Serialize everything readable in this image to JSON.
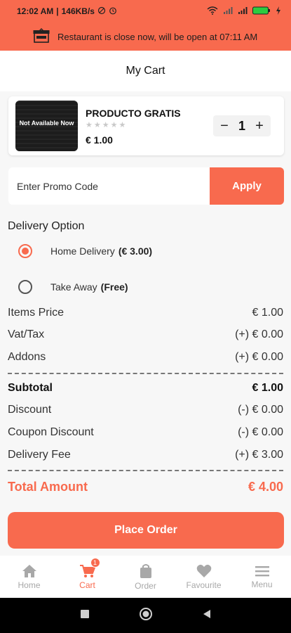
{
  "status_bar": {
    "time": "12:02 AM",
    "network_speed": "146KB/s",
    "battery": "100"
  },
  "banner": {
    "message": "Restaurant is close now, will be open at 07:11 AM",
    "icon": "shop-icon"
  },
  "header": {
    "title": "My Cart"
  },
  "cart": {
    "items": [
      {
        "name": "PRODUCTO GRATIS",
        "price": "€ 1.00",
        "quantity": "1",
        "image_overlay": "Not Available Now",
        "rating_stars": "★★★★★",
        "rating": 0
      }
    ]
  },
  "promo": {
    "placeholder": "Enter Promo Code",
    "value": "",
    "apply_label": "Apply"
  },
  "delivery": {
    "title": "Delivery Option",
    "options": [
      {
        "label": "Home Delivery",
        "fee": "(€ 3.00)",
        "selected": true
      },
      {
        "label": "Take Away",
        "fee": "(Free)",
        "selected": false
      }
    ]
  },
  "summary": {
    "items_price": {
      "label": "Items Price",
      "value": "€ 1.00"
    },
    "vat": {
      "label": "Vat/Tax",
      "value": "(+) € 0.00"
    },
    "addons": {
      "label": "Addons",
      "value": "(+) € 0.00"
    },
    "subtotal": {
      "label": "Subtotal",
      "value": "€ 1.00"
    },
    "discount": {
      "label": "Discount",
      "value": "(-) € 0.00"
    },
    "coupon_discount": {
      "label": "Coupon Discount",
      "value": "(-) € 0.00"
    },
    "delivery_fee": {
      "label": "Delivery Fee",
      "value": "(+) € 3.00"
    },
    "total": {
      "label": "Total Amount",
      "value": "€ 4.00"
    }
  },
  "place_order": {
    "label": "Place Order"
  },
  "bottom_nav": {
    "items": [
      {
        "label": "Home",
        "icon": "home-icon"
      },
      {
        "label": "Cart",
        "icon": "cart-icon",
        "badge": "1"
      },
      {
        "label": "Order",
        "icon": "bag-icon"
      },
      {
        "label": "Favourite",
        "icon": "heart-icon"
      },
      {
        "label": "Menu",
        "icon": "menu-icon"
      }
    ]
  },
  "colors": {
    "accent": "#f86a4e",
    "background": "#f7f7f7",
    "inactive_nav": "#a8a8a8"
  }
}
